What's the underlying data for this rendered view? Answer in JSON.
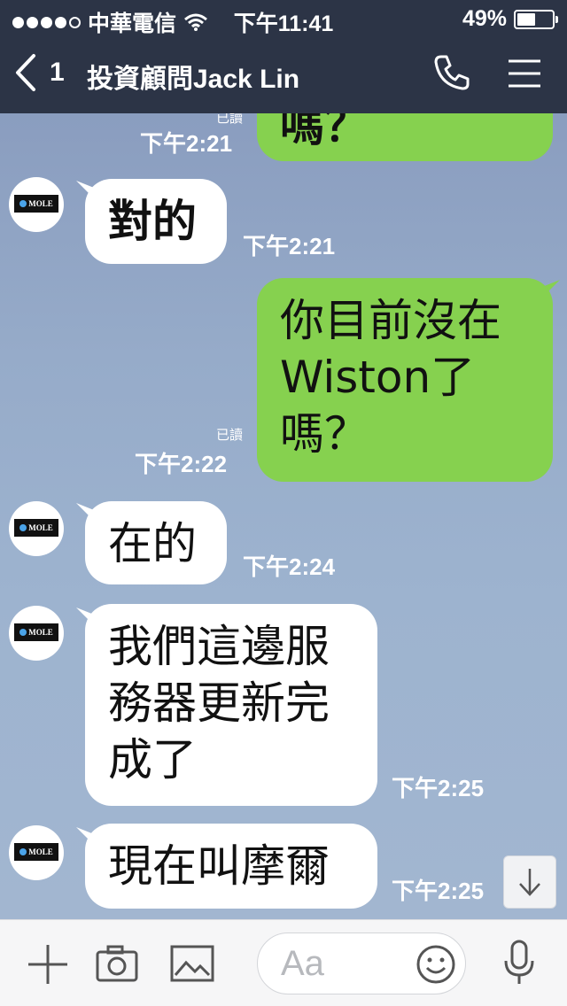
{
  "status_bar": {
    "carrier": "中華電信",
    "time": "下午11:41",
    "battery_percent": "49%",
    "battery_level": 0.49,
    "signal_bars": 4
  },
  "header": {
    "back_count": "1",
    "title": "投資顧問Jack  Lin",
    "icons": [
      "back-chevron-icon",
      "phone-icon",
      "menu-icon"
    ]
  },
  "messages": [
    {
      "side": "out",
      "text": "嗎？",
      "time": "下午2:21",
      "read": "已讀"
    },
    {
      "side": "in",
      "avatar": "MOLE",
      "text": "對的",
      "time": "下午2:21"
    },
    {
      "side": "out",
      "lines": [
        "你目前沒在",
        "Wiston了",
        "嗎？"
      ],
      "time": "下午2:22",
      "read": "已讀"
    },
    {
      "side": "in",
      "avatar": "MOLE",
      "text": "在的",
      "time": "下午2:24"
    },
    {
      "side": "in",
      "avatar": "MOLE",
      "lines": [
        "我們這邊服",
        "務器更新完",
        "成了"
      ],
      "time": "下午2:25"
    },
    {
      "side": "in",
      "avatar": "MOLE",
      "text": "現在叫摩爾",
      "time": "下午2:25"
    }
  ],
  "input_bar": {
    "placeholder": "Aa",
    "icons": [
      "plus-icon",
      "camera-icon",
      "image-icon",
      "emoji-icon",
      "microphone-icon"
    ]
  },
  "colors": {
    "header_bg": "#2c3446",
    "outgoing_bubble": "#86d14f",
    "incoming_bubble": "#ffffff",
    "chat_bg": "#95a9c7"
  }
}
